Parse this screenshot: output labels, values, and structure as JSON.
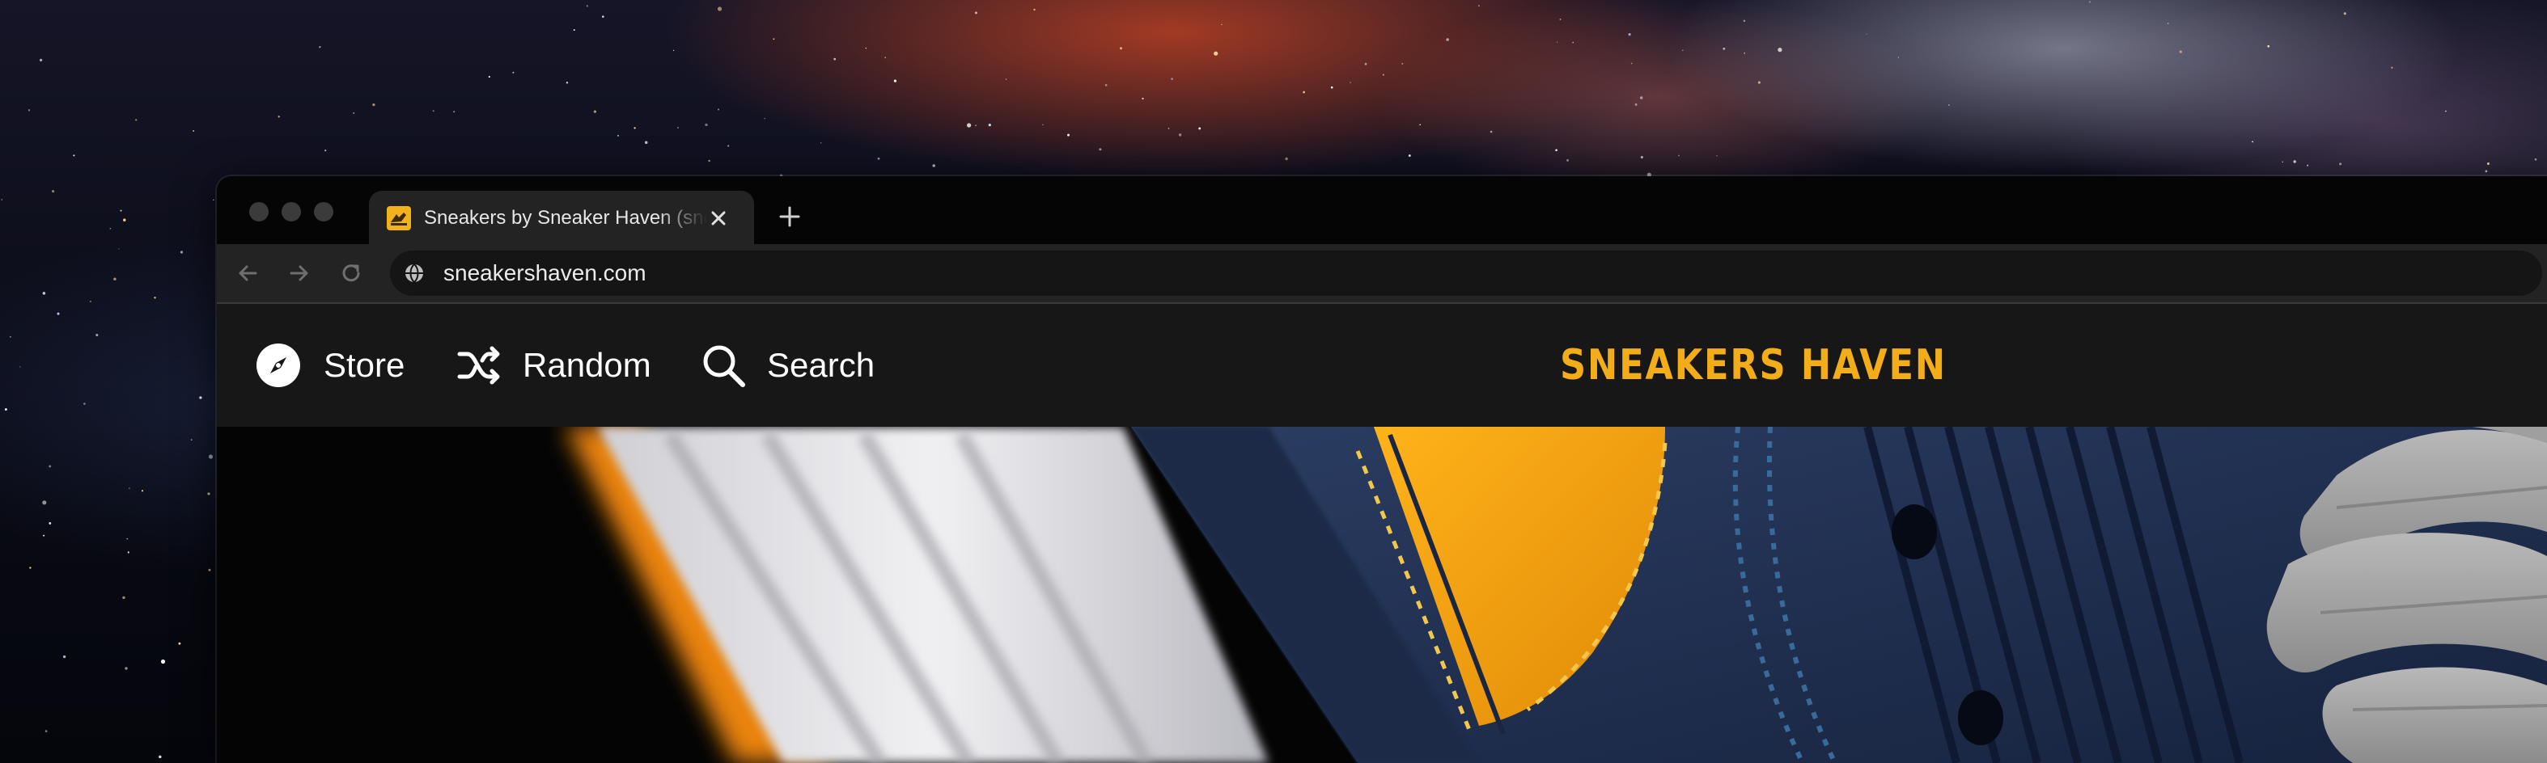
{
  "browser": {
    "tab": {
      "title": "Sneakers by Sneaker Haven (sneakershaven.com)",
      "favicon_icon": "sneaker-favicon-icon",
      "favicon_color": "#f1b21c"
    },
    "address_bar": {
      "url": "sneakershaven.com"
    }
  },
  "site": {
    "nav": [
      {
        "label": "Store",
        "icon": "compass-icon"
      },
      {
        "label": "Random",
        "icon": "shuffle-icon"
      },
      {
        "label": "Search",
        "icon": "search-icon"
      }
    ],
    "logo": "SNEAKERS HAVEN",
    "accent_color": "#f3ad19"
  }
}
